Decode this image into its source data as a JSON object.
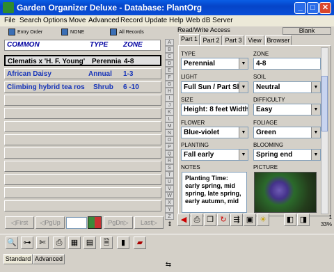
{
  "window": {
    "title": "Garden Organizer Deluxe - Database: PlantOrg"
  },
  "menu": [
    "File",
    "Search",
    "Options",
    "Move",
    "Advanced",
    "Record",
    "Update",
    "Help",
    "Web dB Server"
  ],
  "toolbar": {
    "entry_order": "Entry Order",
    "none": "NONE",
    "all_records": "All Records"
  },
  "list": {
    "headers": {
      "common": "COMMON",
      "type": "TYPE",
      "zone": "ZONE"
    },
    "rows": [
      {
        "common": "Clematis x 'H. F. Young'",
        "type": "Perennia",
        "zone": "4-8"
      },
      {
        "common": "African Daisy",
        "type": "Annual",
        "zone": "1-3"
      },
      {
        "common": "Climbing hybrid tea ros",
        "type": "Shrub",
        "zone": "6 -10"
      }
    ]
  },
  "alphabet": [
    "A",
    "B",
    "C",
    "D",
    "E",
    "F",
    "G",
    "H",
    "I",
    "J",
    "K",
    "L",
    "M",
    "N",
    "O",
    "P",
    "Q",
    "R",
    "S",
    "T",
    "U",
    "V",
    "W",
    "X",
    "Y",
    "Z"
  ],
  "nav": {
    "first": "First",
    "pgup": "PgUp",
    "pgdn": "PgDn",
    "last": "Last"
  },
  "record": {
    "access": "Read/Write Access",
    "mode": "Blank",
    "tabs": [
      "Part 1",
      "Part 2",
      "Part 3",
      "View",
      "Browser"
    ],
    "fields": {
      "type": {
        "label": "TYPE",
        "value": "Perennial"
      },
      "zone": {
        "label": "ZONE",
        "value": "4-8"
      },
      "light": {
        "label": "LIGHT",
        "value": "Full Sun / Part Sh"
      },
      "soil": {
        "label": "SOIL",
        "value": "Neutral"
      },
      "size": {
        "label": "SIZE",
        "value": "Height: 8 feet  Width"
      },
      "difficulty": {
        "label": "DIFFICULTY",
        "value": "Easy"
      },
      "flower": {
        "label": "FLOWER",
        "value": "Blue-violet"
      },
      "foliage": {
        "label": "FOLIAGE",
        "value": "Green"
      },
      "planting": {
        "label": "PLANTING",
        "value": "Fall early"
      },
      "blooming": {
        "label": "BLOOMING",
        "value": "Spring end"
      },
      "notes": {
        "label": "NOTES",
        "value": "Planting Time: early spring, mid spring, late spring, early autumn, mid"
      },
      "picture": {
        "label": "PICTURE"
      }
    },
    "counter": {
      "record_no": "1",
      "percent": "33%"
    }
  },
  "bottom_tabs": [
    "Standard",
    "Advanced"
  ]
}
